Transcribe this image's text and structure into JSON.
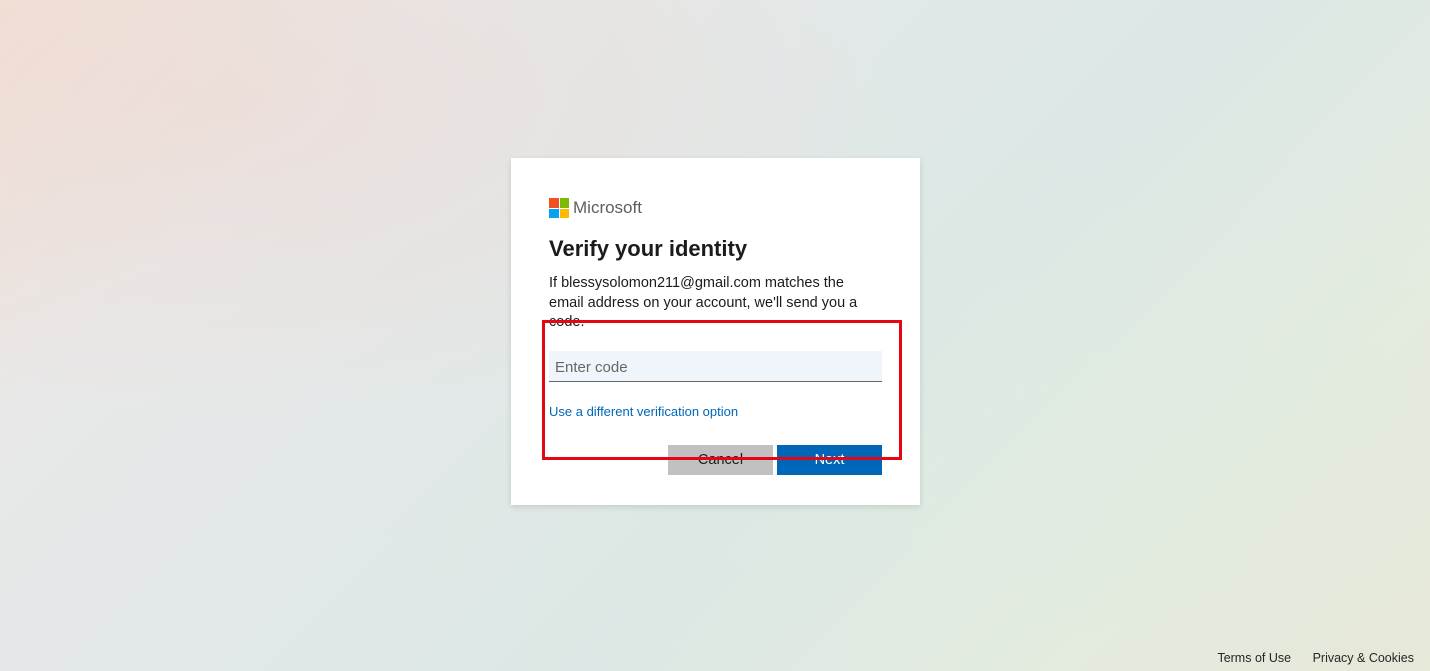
{
  "brand": {
    "name": "Microsoft"
  },
  "title": "Verify your identity",
  "description": "If blessysolomon211@gmail.com matches the email address on your account, we'll send you a code.",
  "input": {
    "placeholder": "Enter code",
    "value": ""
  },
  "links": {
    "alt_verification": "Use a different verification option"
  },
  "buttons": {
    "cancel": "Cancel",
    "next": "Next"
  },
  "footer": {
    "terms": "Terms of Use",
    "privacy": "Privacy & Cookies"
  }
}
